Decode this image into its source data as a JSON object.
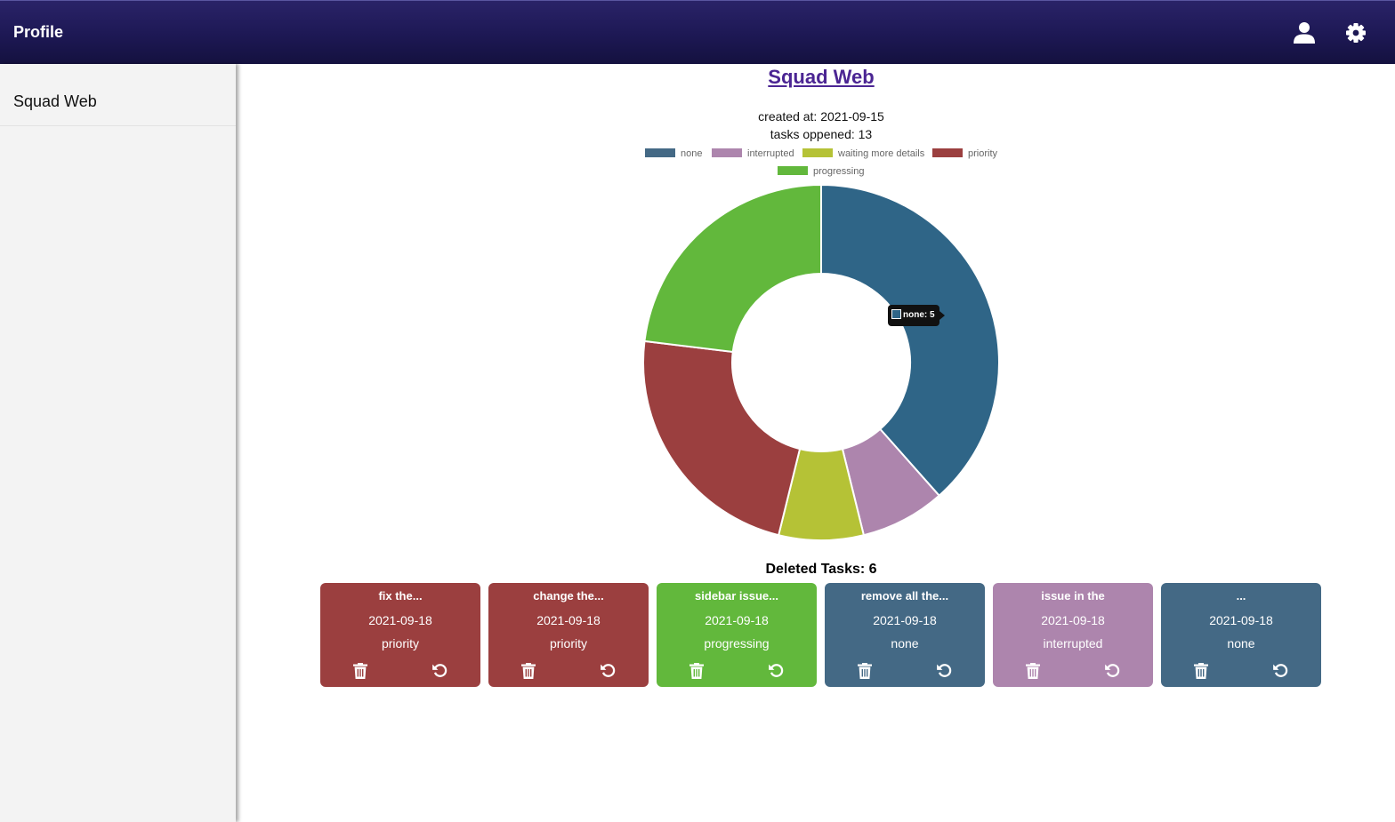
{
  "header": {
    "title": "Profile",
    "user_icon": "user-icon",
    "settings_icon": "gear-icon"
  },
  "sidebar": {
    "items": [
      {
        "label": "Squad Web"
      }
    ]
  },
  "squad": {
    "name": "Squad Web",
    "created_at": "created at: 2021-09-15",
    "tasks_opened": "tasks oppened: 13"
  },
  "colors": {
    "none": "#2f6587",
    "interrupted": "#ad85ad",
    "waiting": "#b5c236",
    "priority": "#9b3f3f",
    "progressing": "#62b83c",
    "card_none": "#446985"
  },
  "chart_data": {
    "type": "pie",
    "variant": "doughnut",
    "categories": [
      "none",
      "interrupted",
      "waiting more details",
      "priority",
      "progressing"
    ],
    "values": [
      5,
      1,
      1,
      3,
      3
    ],
    "colors": [
      "#2f6587",
      "#ad85ad",
      "#b5c236",
      "#9b3f3f",
      "#62b83c"
    ],
    "legend_placement": "top",
    "tooltip": "none: 5"
  },
  "deleted": {
    "title": "Deleted Tasks: 6",
    "cards": [
      {
        "title": "fix the...",
        "date": "2021-09-18",
        "status": "priority",
        "color": "#9b3f3f"
      },
      {
        "title": "change the...",
        "date": "2021-09-18",
        "status": "priority",
        "color": "#9b3f3f"
      },
      {
        "title": "sidebar issue...",
        "date": "2021-09-18",
        "status": "progressing",
        "color": "#62b83c"
      },
      {
        "title": "remove all the...",
        "date": "2021-09-18",
        "status": "none",
        "color": "#446985"
      },
      {
        "title": "issue in the",
        "date": "2021-09-18",
        "status": "interrupted",
        "color": "#ad85ad"
      },
      {
        "title": "...",
        "date": "2021-09-18",
        "status": "none",
        "color": "#446985"
      }
    ]
  }
}
